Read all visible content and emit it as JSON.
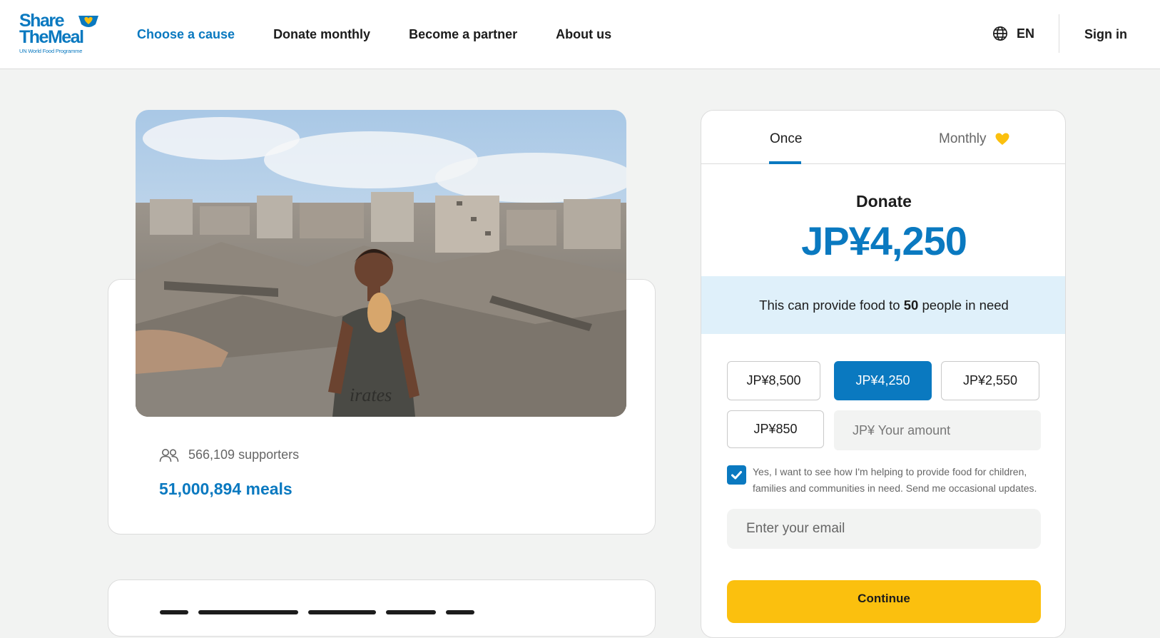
{
  "logo": {
    "line1": "Share",
    "line2": "TheMeal",
    "line3": "UN World Food Programme"
  },
  "nav": {
    "items": [
      {
        "label": "Choose a cause",
        "active": true
      },
      {
        "label": "Donate monthly",
        "active": false
      },
      {
        "label": "Become a partner",
        "active": false
      },
      {
        "label": "About us",
        "active": false
      }
    ],
    "language": "EN",
    "sign_in": "Sign in"
  },
  "cause": {
    "supporters": "566,109 supporters",
    "meals": "51,000,894 meals"
  },
  "donation": {
    "tabs": {
      "once": "Once",
      "monthly": "Monthly"
    },
    "title": "Donate",
    "amount": "JP¥4,250",
    "impact": {
      "prefix": "This can provide food to ",
      "count": "50",
      "suffix": " people in need"
    },
    "options": [
      "JP¥8,500",
      "JP¥4,250",
      "JP¥2,550",
      "JP¥850"
    ],
    "selected_option": "JP¥4,250",
    "custom_placeholder": "JP¥ Your amount",
    "consent_text": "Yes, I want to see how I'm helping to provide food for children, families and communities in need. Send me occasional updates.",
    "consent_checked": true,
    "email_placeholder": "Enter your email",
    "continue_label": "Continue"
  },
  "colors": {
    "brand_blue": "#0a79c0",
    "accent_yellow": "#fbc00e",
    "impact_bg": "#dff0fa"
  },
  "icons": [
    "bowl-heart-icon",
    "globe-icon",
    "heart-icon",
    "people-icon",
    "checkmark-icon"
  ]
}
